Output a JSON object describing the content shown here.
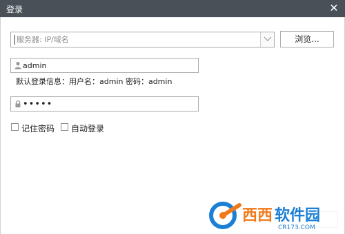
{
  "window": {
    "title": "登录",
    "close_glyph": "✕"
  },
  "server": {
    "placeholder": "服务器: IP/域名",
    "value": ""
  },
  "browse_label": "浏览...",
  "username": {
    "value": "admin",
    "icon": "user-icon"
  },
  "hint": "默认登录信息：用户名：admin 密码：admin",
  "password": {
    "value": "admin",
    "icon": "lock-icon"
  },
  "options": {
    "remember_label": "记住密码",
    "remember_checked": false,
    "autologin_label": "自动登录",
    "autologin_checked": false
  },
  "login_label": "",
  "watermark": {
    "brand": "西西软件园",
    "site": "CR173.COM"
  },
  "colors": {
    "titlebar": "#4a5058",
    "border": "#a9a9a9",
    "watermark_orange": "#f07a1a",
    "watermark_blue": "#1b7fd6"
  }
}
